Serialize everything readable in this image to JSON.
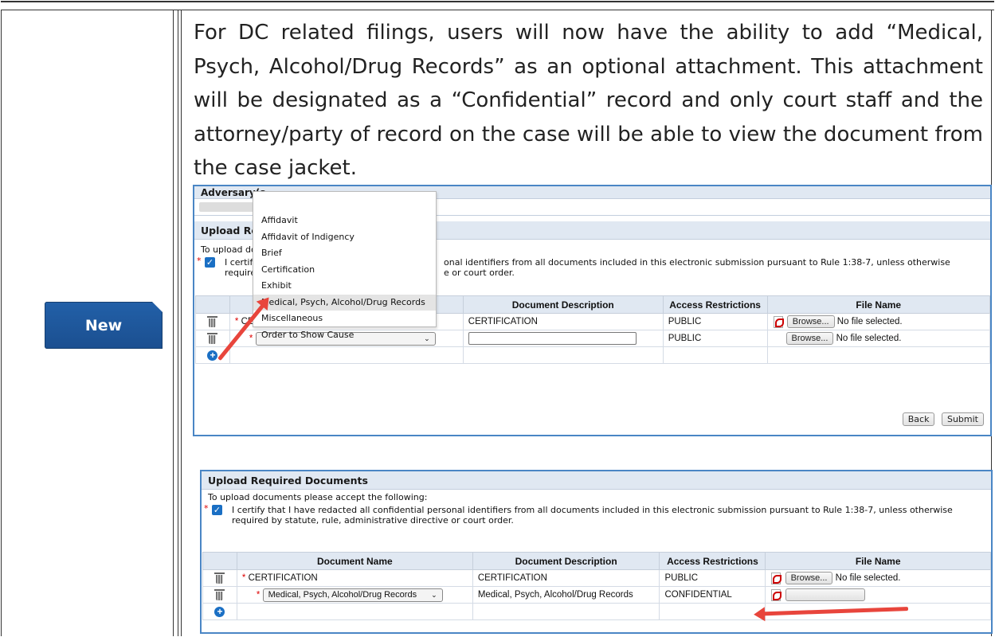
{
  "badge": "New",
  "intro": "For DC related filings, users will now have the ability to add “Medical, Psych, Alcohol/Drug Records” as an optional attachment. This attachment will be designated as a “Confidential” record and only court staff and the attorney/party of record on the case will be able to view the document from the case jacket.",
  "top_panel": {
    "adversary_label": "Adversary(s",
    "section_title": "Upload Req",
    "instruction": "To upload doc",
    "certify_a": "I certify",
    "certify_b": "onal identifiers from all documents included in this electronic submission pursuant to Rule 1:38-7, unless otherwise",
    "certify_c": "require",
    "certify_d": "e or court order.",
    "columns": [
      "Document Description",
      "Access Restrictions",
      "File Name"
    ],
    "row1": {
      "name_fragment": "CE",
      "description": "CERTIFICATION",
      "access": "PUBLIC",
      "browse": "Browse...",
      "file_status": "No file selected."
    },
    "row2": {
      "access": "PUBLIC",
      "browse": "Browse...",
      "file_status": "No file selected."
    },
    "back": "Back",
    "submit": "Submit"
  },
  "dropdown_options": [
    "Affidavit",
    "Affidavit of Indigency",
    "Brief",
    "Certification",
    "Exhibit",
    "Medical, Psych, Alcohol/Drug Records",
    "Miscellaneous",
    "Order to Show Cause"
  ],
  "bottom_panel": {
    "section_title": "Upload Required Documents",
    "instruction": "To upload documents please accept the following:",
    "certify_line1": "I certify that I have redacted all confidential personal identifiers from all documents included in this electronic submission pursuant to Rule 1:38-7, unless otherwise",
    "certify_line2": "required by statute, rule, administrative directive or court order.",
    "columns": [
      "Document Name",
      "Document Description",
      "Access Restrictions",
      "File Name"
    ],
    "row1": {
      "name": "CERTIFICATION",
      "description": "CERTIFICATION",
      "access": "PUBLIC",
      "browse": "Browse...",
      "file_status": "No file selected."
    },
    "row2": {
      "name": "Medical, Psych, Alcohol/Drug Records",
      "description": "Medical, Psych, Alcohol/Drug Records",
      "access": "CONFIDENTIAL"
    }
  },
  "colors": {
    "badge": "#1b4f90",
    "accent": "#1a6fc4",
    "arrow": "#e8453c",
    "header_bg": "#e0e8f2"
  }
}
